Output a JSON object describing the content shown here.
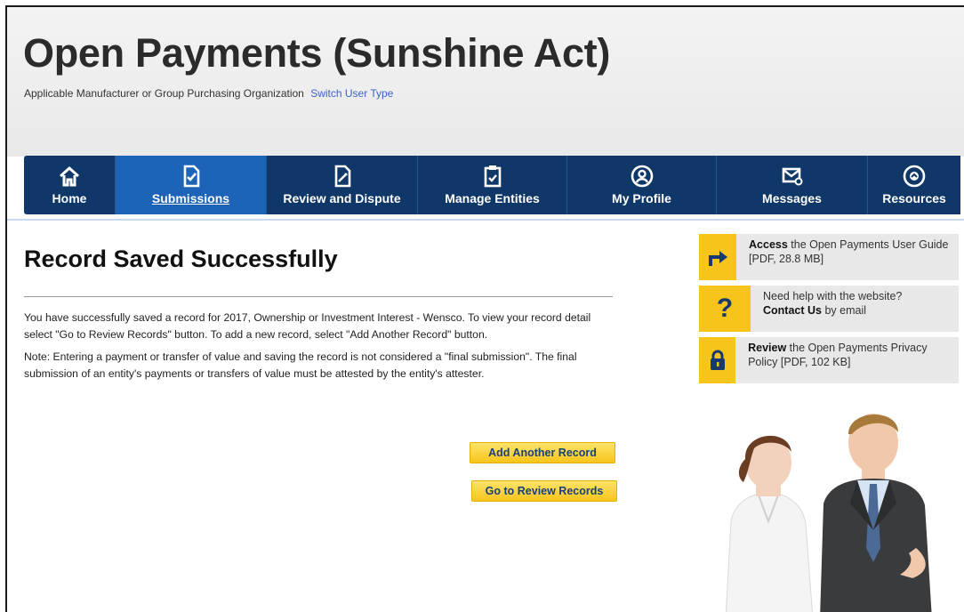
{
  "header": {
    "title": "Open Payments (Sunshine Act)",
    "user_type": "Applicable Manufacturer or Group Purchasing Organization",
    "switch_link": "Switch User Type"
  },
  "nav": {
    "items": [
      {
        "label": "Home",
        "icon": "home-icon"
      },
      {
        "label": "Submissions",
        "icon": "document-check-icon",
        "active": true
      },
      {
        "label": "Review and Dispute",
        "icon": "document-edit-icon"
      },
      {
        "label": "Manage Entities",
        "icon": "clipboard-icon"
      },
      {
        "label": "My Profile",
        "icon": "user-circle-icon"
      },
      {
        "label": "Messages",
        "icon": "envelope-icon"
      },
      {
        "label": "Resources",
        "icon": "chevron-up-circle-icon"
      }
    ]
  },
  "main": {
    "title": "Record Saved Successfully",
    "message": "You have successfully saved a record for 2017, Ownership or Investment Interest - Wensco. To view your record detail select \"Go to Review Records\" button. To add a new record, select \"Add Another Record\" button.",
    "note": "Note: Entering a payment or transfer of value and saving the record is not considered a \"final submission\". The final submission of an entity's payments or transfers of value must be attested by the entity's attester.",
    "add_button": "Add Another Record",
    "review_button": "Go to Review Records"
  },
  "sidebar": {
    "user_guide": {
      "bold": "Access",
      "text": " the Open Payments User Guide [PDF, 28.8 MB]"
    },
    "help": {
      "line1": "Need help with the website?",
      "bold": "Contact Us",
      "text": " by email"
    },
    "privacy": {
      "bold": "Review",
      "text": " the Open Payments Privacy Policy [PDF, 102 KB]"
    },
    "help_icon_glyph": "?"
  },
  "colors": {
    "nav_bg": "#0f3768",
    "nav_active": "#1d63b8",
    "button_yellow": "#f6c51b",
    "icon_yellow": "#f7c41b",
    "link_blue": "#3b64c4"
  }
}
